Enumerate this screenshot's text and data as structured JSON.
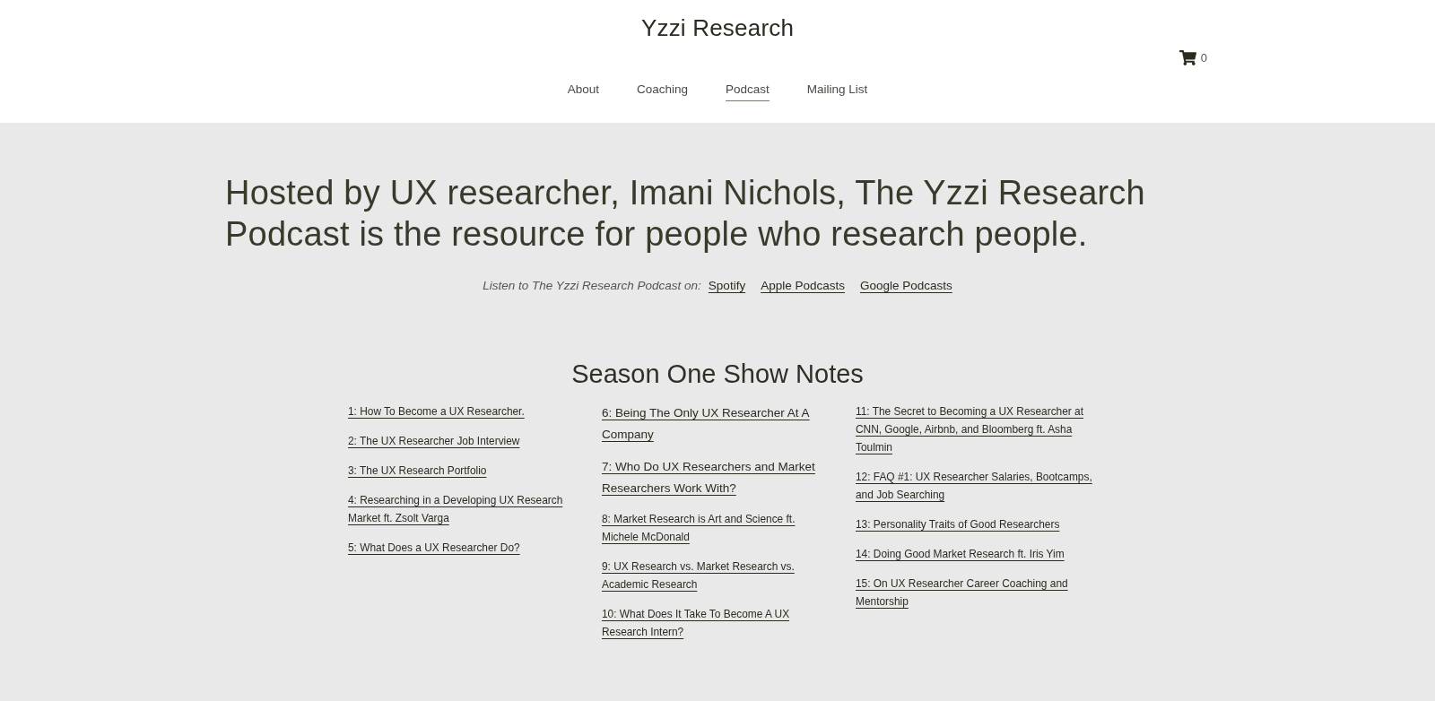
{
  "header": {
    "site_title": "Yzzi Research",
    "cart": {
      "count": "0"
    },
    "nav": [
      {
        "label": "About",
        "selected": false
      },
      {
        "label": "Coaching",
        "selected": false
      },
      {
        "label": "Podcast",
        "selected": true
      },
      {
        "label": "Mailing List",
        "selected": false
      }
    ]
  },
  "hero": {
    "headline": "Hosted by UX researcher, Imani Nichols, The Yzzi Research Podcast is the resource for people who research people.",
    "listen": {
      "label": "Listen to The Yzzi Research Podcast on:",
      "links": [
        "Spotify",
        "Apple Podcasts",
        "Google Podcasts"
      ]
    }
  },
  "show_notes": {
    "title": "Season One Show Notes",
    "columns": [
      [
        {
          "title": "1: How To Become a UX Researcher.",
          "kind": "small"
        },
        {
          "title": "2: The UX Researcher Job Interview",
          "kind": "small"
        },
        {
          "title": "3: The UX Research Portfolio",
          "kind": "small"
        },
        {
          "title": "4: Researching in a Developing UX Research Market ft. Zsolt Varga",
          "kind": "small"
        },
        {
          "title": "5: What Does a UX Researcher Do?",
          "kind": "small"
        }
      ],
      [
        {
          "title": "6: Being The Only UX Researcher At A Company",
          "kind": "large"
        },
        {
          "title": "7: Who Do UX Researchers and Market Researchers Work With?",
          "kind": "large"
        },
        {
          "title": "8: Market Research is Art and Science ft. Michele McDonald",
          "kind": "small"
        },
        {
          "title": "9: UX Research vs. Market Research vs. Academic Research",
          "kind": "small"
        },
        {
          "title": "10: What Does It Take To Become A UX Research Intern?",
          "kind": "small"
        }
      ],
      [
        {
          "title": "11: The Secret to Becoming a UX Researcher at CNN, Google, Airbnb, and Bloomberg ft. Asha Toulmin",
          "kind": "small"
        },
        {
          "title": "12: FAQ #1: UX Researcher Salaries, Bootcamps, and Job Searching",
          "kind": "small"
        },
        {
          "title": "13: Personality Traits of Good Researchers",
          "kind": "small"
        },
        {
          "title": "14: Doing Good Market Research ft. Iris Yim",
          "kind": "small"
        },
        {
          "title": "15: On UX Researcher Career Coaching and Mentorship",
          "kind": "small"
        }
      ]
    ]
  }
}
